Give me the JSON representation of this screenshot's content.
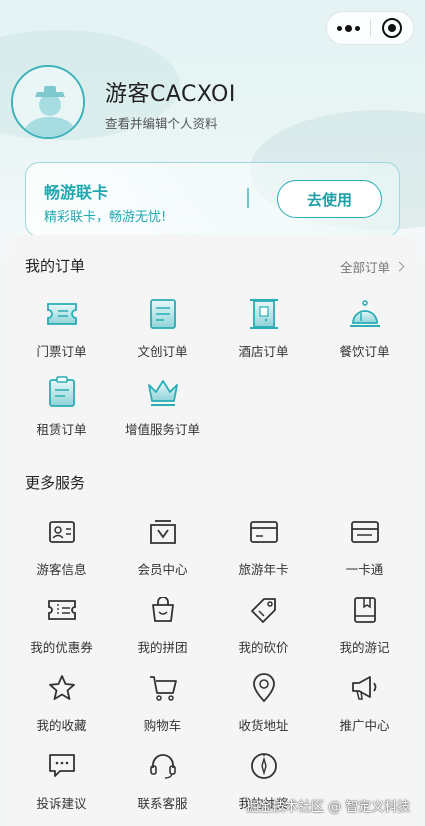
{
  "profile": {
    "username": "游客CACXOI",
    "subtitle": "查看并编辑个人资料"
  },
  "vip_card": {
    "title": "畅游联卡",
    "subtitle": "精彩联卡，畅游无忧!",
    "button": "去使用"
  },
  "orders": {
    "title": "我的订单",
    "all_link": "全部订单",
    "items": [
      {
        "label": "门票订单",
        "icon": "ticket-icon"
      },
      {
        "label": "文创订单",
        "icon": "creative-icon"
      },
      {
        "label": "酒店订单",
        "icon": "hotel-icon"
      },
      {
        "label": "餐饮订单",
        "icon": "dining-icon"
      },
      {
        "label": "租赁订单",
        "icon": "rental-icon"
      },
      {
        "label": "增值服务订单",
        "icon": "crown-icon"
      }
    ]
  },
  "services": {
    "title": "更多服务",
    "items": [
      {
        "label": "游客信息",
        "icon": "id-card-icon"
      },
      {
        "label": "会员中心",
        "icon": "member-icon"
      },
      {
        "label": "旅游年卡",
        "icon": "annual-card-icon"
      },
      {
        "label": "一卡通",
        "icon": "card-icon"
      },
      {
        "label": "我的优惠券",
        "icon": "coupon-icon"
      },
      {
        "label": "我的拼团",
        "icon": "group-bag-icon"
      },
      {
        "label": "我的砍价",
        "icon": "price-tag-icon"
      },
      {
        "label": "我的游记",
        "icon": "notebook-icon"
      },
      {
        "label": "我的收藏",
        "icon": "star-icon"
      },
      {
        "label": "购物车",
        "icon": "cart-icon"
      },
      {
        "label": "收货地址",
        "icon": "location-icon"
      },
      {
        "label": "推广中心",
        "icon": "megaphone-icon"
      },
      {
        "label": "投诉建议",
        "icon": "feedback-icon"
      },
      {
        "label": "联系客服",
        "icon": "headset-icon"
      },
      {
        "label": "我的抽奖",
        "icon": "compass-icon"
      }
    ]
  },
  "watermark": "掘金技术社区 @ 智定义科技",
  "colors": {
    "accent": "#2aadb5",
    "accent_light": "#9ed7da",
    "text": "#333333"
  }
}
